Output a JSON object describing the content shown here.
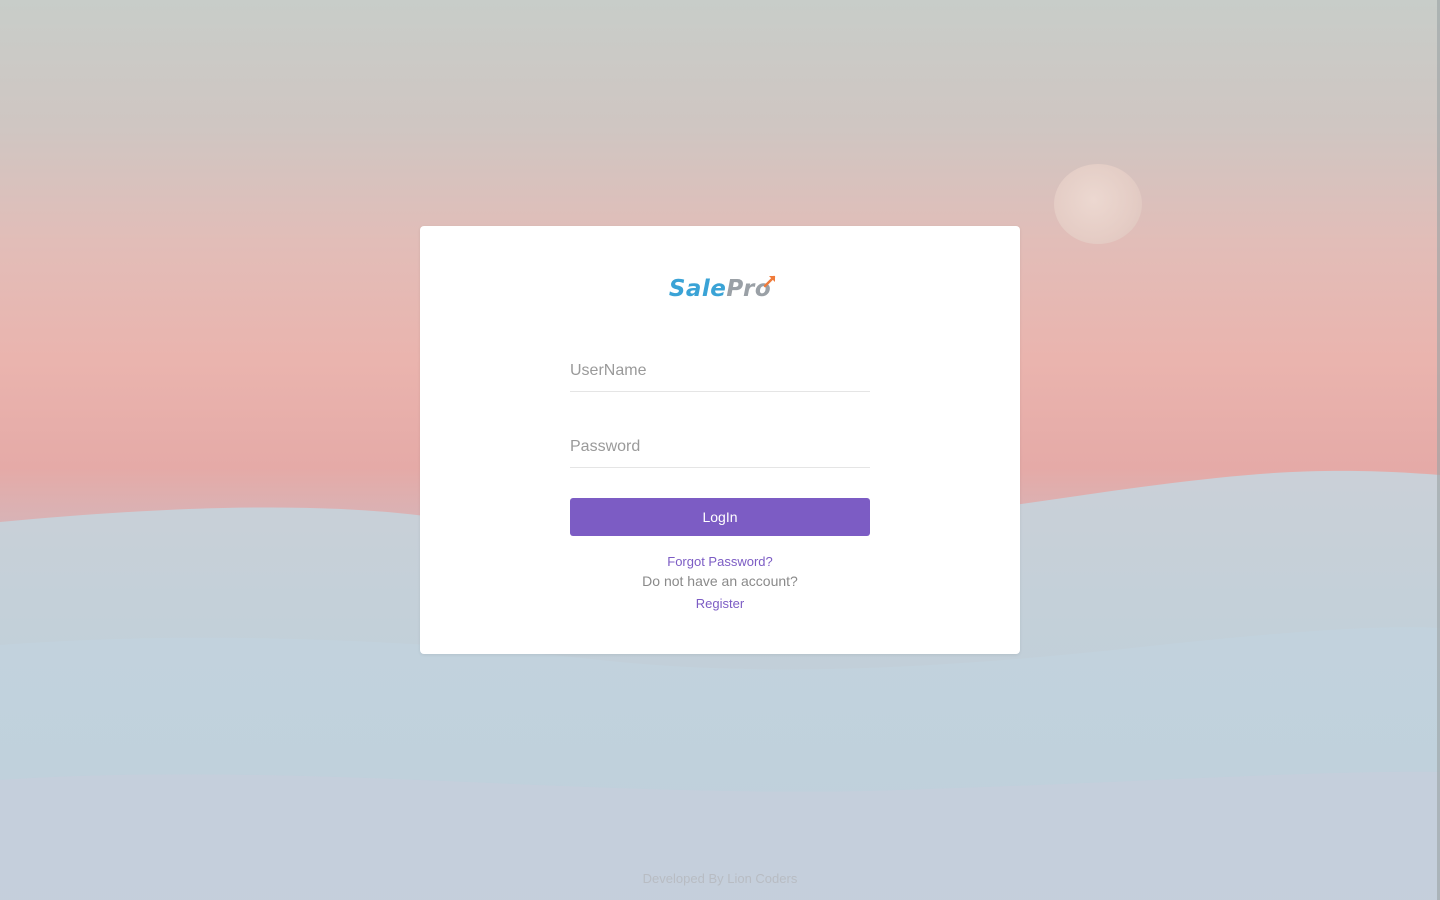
{
  "brand": {
    "part1": "Sale",
    "part2": "Pro",
    "sale_color": "#3aa3d6",
    "pro_color": "#9aa0a6",
    "arrow_color": "#f07b3a"
  },
  "login_form": {
    "username_placeholder": "UserName",
    "password_placeholder": "Password",
    "username_value": "",
    "password_value": "",
    "submit_label": "LogIn",
    "forgot_password": "Forgot Password?",
    "no_account_text": "Do not have an account?",
    "register_label": "Register"
  },
  "footer": {
    "text": "Developed By Lion Coders"
  },
  "colors": {
    "accent": "#7c5cc4",
    "card": "#ffffff"
  },
  "icons": {
    "logo_arrow": "upward-arrow-icon"
  }
}
